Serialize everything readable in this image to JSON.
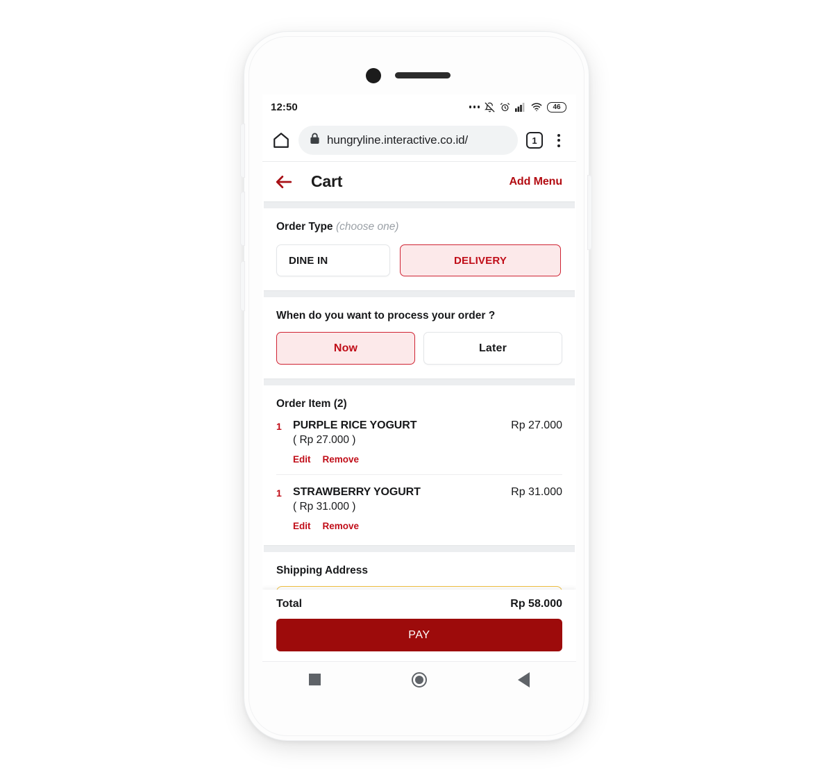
{
  "device": {
    "status_bar": {
      "time": "12:50",
      "icons": [
        "more-dots",
        "notifications-muted",
        "alarm",
        "cellular-signal",
        "wifi"
      ],
      "battery_level": "46"
    },
    "nav_bar": {
      "recents": "recents-square",
      "home": "home-circle",
      "back": "back-triangle"
    }
  },
  "browser": {
    "home_icon": "home-icon",
    "lock_icon": "lock-icon",
    "url": "hungryline.interactive.co.id/",
    "tab_count": "1",
    "menu_icon": "kebab-menu-icon"
  },
  "header": {
    "back_icon": "arrow-left-icon",
    "title": "Cart",
    "action_label": "Add Menu"
  },
  "order_type": {
    "label": "Order Type",
    "hint": "(choose one)",
    "options": [
      {
        "label": "DINE IN",
        "selected": false
      },
      {
        "label": "DELIVERY",
        "selected": true
      }
    ]
  },
  "timing": {
    "question": "When do you want to process your order ?",
    "options": [
      {
        "label": "Now",
        "selected": true
      },
      {
        "label": "Later",
        "selected": false
      }
    ]
  },
  "order_items": {
    "title": "Order Item (2)",
    "edit_label": "Edit",
    "remove_label": "Remove",
    "items": [
      {
        "qty": "1",
        "name": "PURPLE RICE YOGURT",
        "unit_price": "( Rp 27.000 )",
        "line_total": "Rp 27.000"
      },
      {
        "qty": "1",
        "name": "STRAWBERRY YOGURT",
        "unit_price": "( Rp 31.000 )",
        "line_total": "Rp 31.000"
      }
    ]
  },
  "shipping": {
    "title": "Shipping Address",
    "input_value": "",
    "input_placeholder": ""
  },
  "footer": {
    "total_label": "Total",
    "total_value": "Rp 58.000",
    "pay_label": "PAY"
  },
  "colors": {
    "brand_red": "#c00d18",
    "pay_red": "#9d0b0b",
    "selected_fill": "#fce9ea",
    "selected_border": "#cf2232",
    "address_border": "#f0c040",
    "band_gray": "#eceef0"
  }
}
